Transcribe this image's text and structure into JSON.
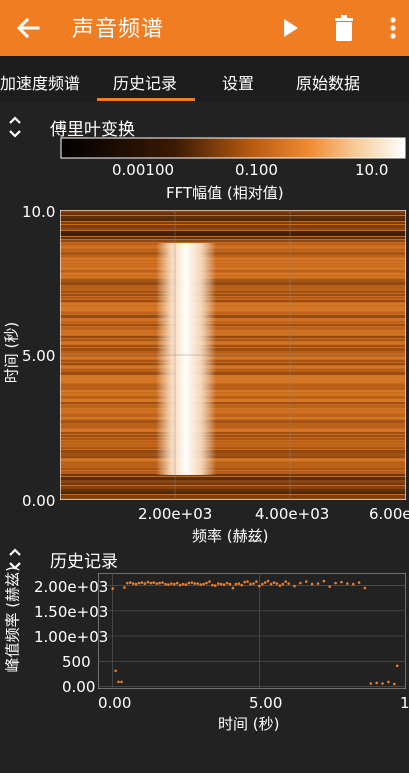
{
  "app": {
    "title": "声音频谱",
    "icons": {
      "back": "arrow-back-icon",
      "play": "play-icon",
      "delete": "trash-icon",
      "more": "more-vert-icon"
    },
    "accent_color": "#f07d22"
  },
  "tabs": [
    {
      "label": "加速度频谱"
    },
    {
      "label": "历史记录",
      "selected": true
    },
    {
      "label": "设置"
    },
    {
      "label": "原始数据"
    }
  ],
  "fft_section": {
    "title": "傅里叶变换",
    "colorbar": {
      "ticks": [
        "0.00100",
        "0.100",
        "10.0"
      ],
      "label": "FFT幅值 (相对值)"
    },
    "spectrogram": {
      "xlabel": "频率 (赫兹)",
      "ylabel": "时间 (秒)",
      "x_ticks": [
        "2.00e+03",
        "4.00e+03",
        "6.00e"
      ],
      "y_ticks": [
        "10.0",
        "5.00",
        "0.00"
      ]
    }
  },
  "history_section": {
    "title": "历史记录",
    "chart_data": {
      "type": "scatter",
      "xlabel": "时间 (秒)",
      "ylabel": "峰值频率 (赫兹)",
      "x_ticks": [
        "0.00",
        "5.00",
        "1"
      ],
      "y_ticks": [
        "2.00e+03",
        "1.50e+03",
        "1.00e+03",
        "500",
        "0.00"
      ],
      "xlim": [
        -0.5,
        10.0
      ],
      "ylim": [
        -50,
        2250
      ],
      "grid": true,
      "series": [
        {
          "color": "#f07d22",
          "x": [
            0.0,
            0.1,
            0.2,
            0.3,
            0.4,
            0.5,
            0.6,
            0.7,
            0.8,
            0.9,
            1.0,
            1.1,
            1.2,
            1.3,
            1.4,
            1.5,
            1.6,
            1.7,
            1.8,
            1.9,
            2.0,
            2.1,
            2.2,
            2.3,
            2.4,
            2.5,
            2.6,
            2.7,
            2.8,
            2.9,
            3.0,
            3.1,
            3.2,
            3.3,
            3.4,
            3.5,
            3.6,
            3.7,
            3.8,
            3.9,
            4.0,
            4.1,
            4.2,
            4.3,
            4.4,
            4.5,
            4.6,
            4.7,
            4.8,
            4.9,
            5.0,
            5.1,
            5.2,
            5.3,
            5.4,
            5.5,
            5.6,
            5.7,
            5.8,
            5.9,
            6.0,
            6.2,
            6.4,
            6.6,
            6.8,
            7.0,
            7.2,
            7.4,
            7.6,
            7.8,
            8.0,
            8.2,
            8.4,
            8.6,
            8.8,
            9.0,
            9.2,
            9.4,
            9.6,
            9.7
          ],
          "y": [
            1940,
            310,
            90,
            90,
            1960,
            2050,
            2060,
            2040,
            2030,
            2050,
            2060,
            2040,
            2070,
            2050,
            2060,
            2040,
            2050,
            2060,
            2030,
            2020,
            2040,
            2030,
            2050,
            2010,
            2030,
            2020,
            2050,
            2060,
            2040,
            2040,
            2020,
            2030,
            2050,
            2080,
            2010,
            2000,
            2040,
            2030,
            2020,
            2050,
            2030,
            1950,
            2030,
            2040,
            2010,
            2070,
            2080,
            2030,
            2040,
            2080,
            1990,
            2030,
            2060,
            2090,
            2030,
            2060,
            2040,
            2000,
            2030,
            2080,
            2040,
            1990,
            2050,
            2080,
            2030,
            2040,
            2090,
            1980,
            2050,
            2070,
            2040,
            2030,
            2060,
            1950,
            60,
            70,
            60,
            90,
            50,
            410
          ]
        }
      ]
    }
  }
}
